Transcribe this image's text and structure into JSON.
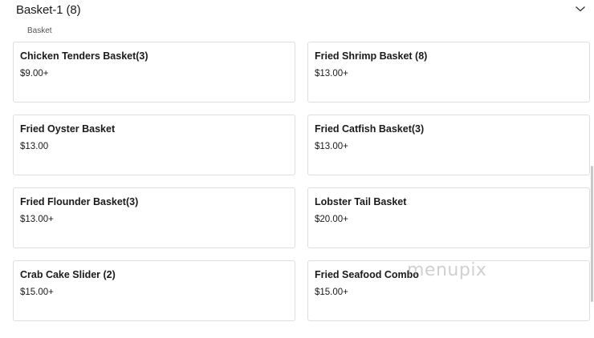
{
  "section": {
    "title": "Basket-1 (8)",
    "subtitle": "Basket",
    "toggle_icon": "chevron-down-icon"
  },
  "items": [
    {
      "name": "Chicken Tenders Basket(3)",
      "price": "$9.00+"
    },
    {
      "name": "Fried Shrimp Basket (8)",
      "price": "$13.00+"
    },
    {
      "name": "Fried Oyster Basket",
      "price": "$13.00"
    },
    {
      "name": "Fried Catfish Basket(3)",
      "price": "$13.00+"
    },
    {
      "name": "Fried Flounder Basket(3)",
      "price": "$13.00+"
    },
    {
      "name": "Lobster Tail Basket",
      "price": "$20.00+"
    },
    {
      "name": "Crab Cake Slider (2)",
      "price": "$15.00+"
    },
    {
      "name": "Fried Seafood Combo",
      "price": "$15.00+"
    }
  ],
  "watermark": "menupix"
}
